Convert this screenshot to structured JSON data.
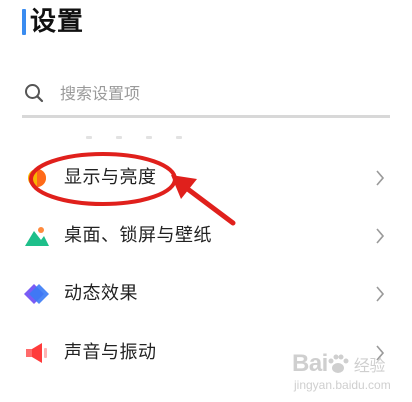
{
  "header": {
    "title": "设置"
  },
  "search": {
    "placeholder": "搜索设置项",
    "icon": "search-icon"
  },
  "menu": {
    "items": [
      {
        "label": "显示与亮度",
        "icon": "display-brightness-icon"
      },
      {
        "label": "桌面、锁屏与壁纸",
        "icon": "wallpaper-icon"
      },
      {
        "label": "动态效果",
        "icon": "dynamic-effects-icon"
      },
      {
        "label": "声音与振动",
        "icon": "sound-vibration-icon"
      }
    ]
  },
  "annotation": {
    "color": "#e0201c"
  },
  "colors": {
    "accent": "#3a8cf0"
  },
  "watermark": {
    "brand_left": "Bai",
    "brand_right": "经验",
    "url": "jingyan.baidu.com"
  }
}
